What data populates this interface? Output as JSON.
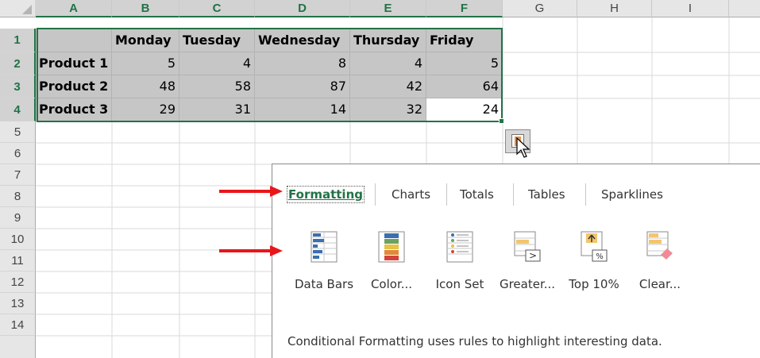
{
  "columns": [
    "A",
    "B",
    "C",
    "D",
    "E",
    "F",
    "G",
    "H",
    "I"
  ],
  "rows": [
    "1",
    "2",
    "3",
    "4",
    "5",
    "6",
    "7",
    "8",
    "9",
    "10",
    "11",
    "12",
    "13",
    "14"
  ],
  "table": {
    "headers": [
      "",
      "Monday",
      "Tuesday",
      "Wednesday",
      "Thursday",
      "Friday"
    ],
    "data": [
      [
        "Product 1",
        "5",
        "4",
        "8",
        "4",
        "5"
      ],
      [
        "Product 2",
        "48",
        "58",
        "87",
        "42",
        "64"
      ],
      [
        "Product 3",
        "29",
        "31",
        "14",
        "32",
        "24"
      ]
    ]
  },
  "quick_analysis": {
    "tabs": [
      "Formatting",
      "Charts",
      "Totals",
      "Tables",
      "Sparklines"
    ],
    "active_tab": "Formatting",
    "tools": [
      {
        "label": "Data Bars",
        "icon": "data-bars-icon"
      },
      {
        "label": "Color...",
        "icon": "color-scale-icon"
      },
      {
        "label": "Icon Set",
        "icon": "icon-set-icon"
      },
      {
        "label": "Greater...",
        "icon": "greater-than-icon"
      },
      {
        "label": "Top 10%",
        "icon": "top-10-percent-icon"
      },
      {
        "label": "Clear...",
        "icon": "clear-format-icon"
      }
    ],
    "description": "Conditional Formatting uses rules to highlight interesting data."
  },
  "colors": {
    "accent": "#217346",
    "selection_fill": "#c6c6c6",
    "arrow": "#e8161b"
  }
}
